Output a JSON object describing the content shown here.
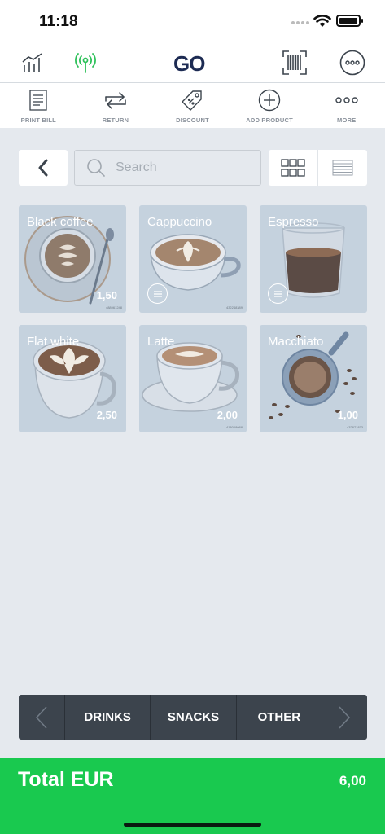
{
  "status_bar": {
    "time": "11:18"
  },
  "nav": {
    "logo": "GO",
    "icons": [
      "chart-icon",
      "antenna-icon",
      "barcode-scanner-icon",
      "more-options-icon"
    ]
  },
  "toolbar": {
    "items": [
      {
        "label": "PRINT BILL",
        "icon": "receipt-icon"
      },
      {
        "label": "RETURN",
        "icon": "return-arrows-icon"
      },
      {
        "label": "DISCOUNT",
        "icon": "tag-icon"
      },
      {
        "label": "ADD PRODUCT",
        "icon": "plus-circle-icon"
      },
      {
        "label": "MORE",
        "icon": "more-dots-icon"
      }
    ]
  },
  "search": {
    "placeholder": "Search"
  },
  "products": [
    {
      "name": "Black coffee",
      "price": "1,50",
      "code": "488961248",
      "has_menu": false
    },
    {
      "name": "Cappuccino",
      "price": "",
      "code": "432248389",
      "has_menu": true
    },
    {
      "name": "Espresso",
      "price": "",
      "code": "",
      "has_menu": true
    },
    {
      "name": "Flat white",
      "price": "2,50",
      "code": "",
      "has_menu": false
    },
    {
      "name": "Latte",
      "price": "2,00",
      "code": "418008088",
      "has_menu": false
    },
    {
      "name": "Macchiato",
      "price": "1,00",
      "code": "432871833",
      "has_menu": false
    }
  ],
  "categories": [
    "DRINKS",
    "SNACKS",
    "OTHER"
  ],
  "total": {
    "label": "Total EUR",
    "value": "6,00"
  },
  "colors": {
    "accent_green": "#19c94f",
    "antenna_green": "#2ec15a",
    "logo_navy": "#1d2b53",
    "category_bar": "#3c444d"
  }
}
